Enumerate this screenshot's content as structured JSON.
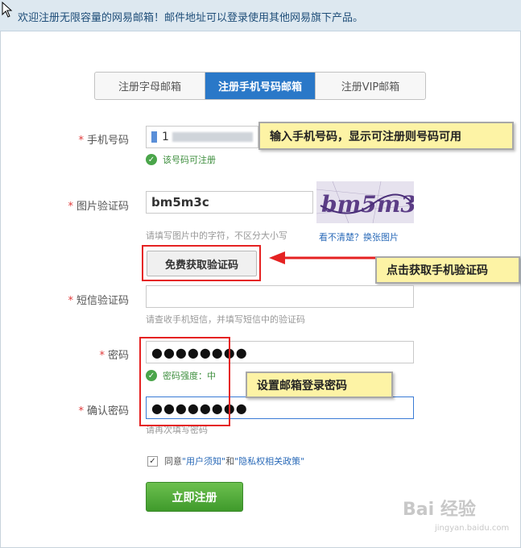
{
  "header": {
    "title": "欢迎注册无限容量的网易邮箱！邮件地址可以登录使用其他网易旗下产品。"
  },
  "tabs": [
    {
      "label": "注册字母邮箱",
      "active": false
    },
    {
      "label": "注册手机号码邮箱",
      "active": true
    },
    {
      "label": "注册VIP邮箱",
      "active": false
    }
  ],
  "form": {
    "phone": {
      "label": "手机号码",
      "value": "1",
      "status": "该号码可注册"
    },
    "captcha": {
      "label": "图片验证码",
      "value": "bm5m3c",
      "hint": "请填写图片中的字符，不区分大小写",
      "refresh_link": "看不清楚？换张图片",
      "image_text": "bm5m3c"
    },
    "sms_button": {
      "label": "免费获取验证码"
    },
    "sms_code": {
      "label": "短信验证码",
      "value": "",
      "hint": "请查收手机短信，并填写短信中的验证码"
    },
    "password": {
      "label": "密码",
      "value": "●●●●●●●●",
      "strength": "密码强度：中"
    },
    "confirm_password": {
      "label": "确认密码",
      "value": "●●●●●●●●",
      "hint": "请再次填写密码"
    },
    "agreement": {
      "prefix": "同意",
      "terms": "\"用户须知\"",
      "and": "和",
      "privacy": "\"隐私权相关政策\"",
      "checked": true
    },
    "submit": {
      "label": "立即注册"
    }
  },
  "callouts": {
    "phone": "输入手机号码，显示可注册则号码可用",
    "sms": "点击获取手机验证码",
    "password": "设置邮箱登录密码"
  },
  "watermark": {
    "brand": "Bai 经验",
    "site": "jingyan.baidu.com"
  },
  "colors": {
    "accent": "#2a78c8",
    "callout_bg": "#fdf3a5",
    "highlight": "#e52222",
    "submit": "#3f9a2b"
  }
}
